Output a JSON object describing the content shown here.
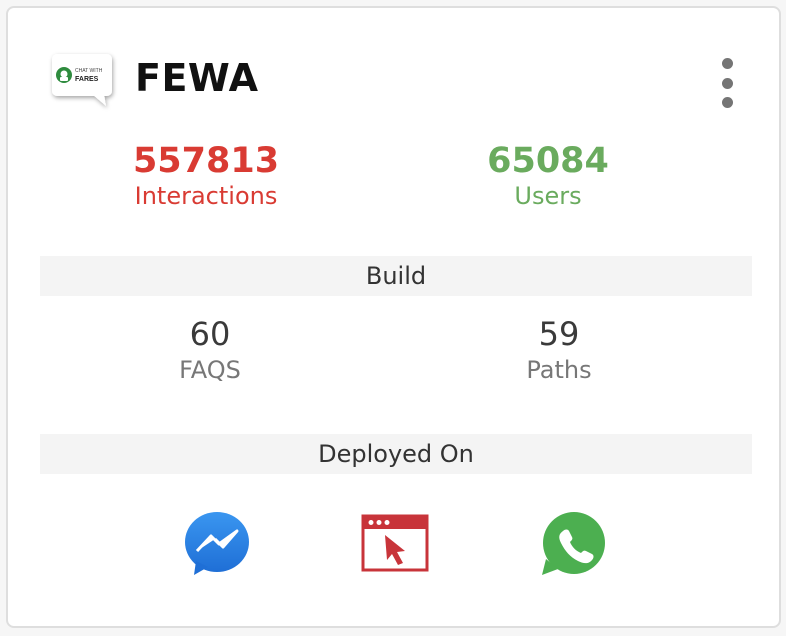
{
  "bot": {
    "name": "FEWA",
    "logo_text_line1": "CHAT WITH",
    "logo_text_line2": "FARES"
  },
  "stats": {
    "interactions": {
      "value": "557813",
      "label": "Interactions",
      "color": "#d93b33"
    },
    "users": {
      "value": "65084",
      "label": "Users",
      "color": "#6aab5e"
    }
  },
  "build": {
    "title": "Build",
    "faqs": {
      "value": "60",
      "label": "FAQS"
    },
    "paths": {
      "value": "59",
      "label": "Paths"
    }
  },
  "deployed": {
    "title": "Deployed On",
    "channels": [
      {
        "name": "messenger-icon",
        "color": "#2f80ed"
      },
      {
        "name": "web-widget-icon",
        "color": "#c8343a"
      },
      {
        "name": "whatsapp-icon",
        "color": "#4caf50"
      }
    ]
  }
}
